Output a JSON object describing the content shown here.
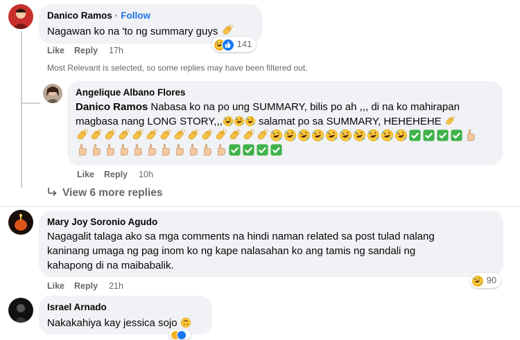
{
  "comments": [
    {
      "author": "Danico Ramos",
      "follow_label": "Follow",
      "text": "Nagawan ko na 'to ng summary guys",
      "like_label": "Like",
      "reply_label": "Reply",
      "time": "17h",
      "reaction_count": "141"
    },
    {
      "author": "Angelique Albano Flores",
      "mention": "Danico Ramos",
      "text_line1": "Nabasa ko na po ung SUMMARY, bilis po ah ,,, di na ko mahirapan",
      "text_line2": "magbasa nang LONG STORY,,,",
      "text_line2b": "salamat po sa SUMMARY, HEHEHEHE",
      "like_label": "Like",
      "reply_label": "Reply",
      "time": "10h"
    },
    {
      "author": "Mary Joy Soronio Agudo",
      "text_line1": "Nagagalit talaga ako sa mga comments na hindi naman related sa post tulad nalang",
      "text_line2": "kaninang umaga ng pag inom ko ng kape nalasahan ko ang tamis ng sandali ng",
      "text_line3": "kahapong di na maibabalik.",
      "like_label": "Like",
      "reply_label": "Reply",
      "time": "21h",
      "reaction_count": "90"
    },
    {
      "author": "Israel Arnado",
      "text": "Nakakahiya kay jessica sojo"
    }
  ],
  "filter_note": "Most Relevant is selected, so some replies may have been filtered out.",
  "view_more_replies": "View 6 more replies",
  "colors": {
    "link_blue": "#1b74e4",
    "bubble_gray": "#f0f2f5",
    "meta_gray": "#65676b"
  },
  "icons": [
    "clapping-hands-emoji",
    "rofl-emoji",
    "check-mark-emoji",
    "pointing-hand-emoji",
    "haha-reaction",
    "like-reaction",
    "upside-down-face-emoji",
    "reply-arrow-icon"
  ]
}
